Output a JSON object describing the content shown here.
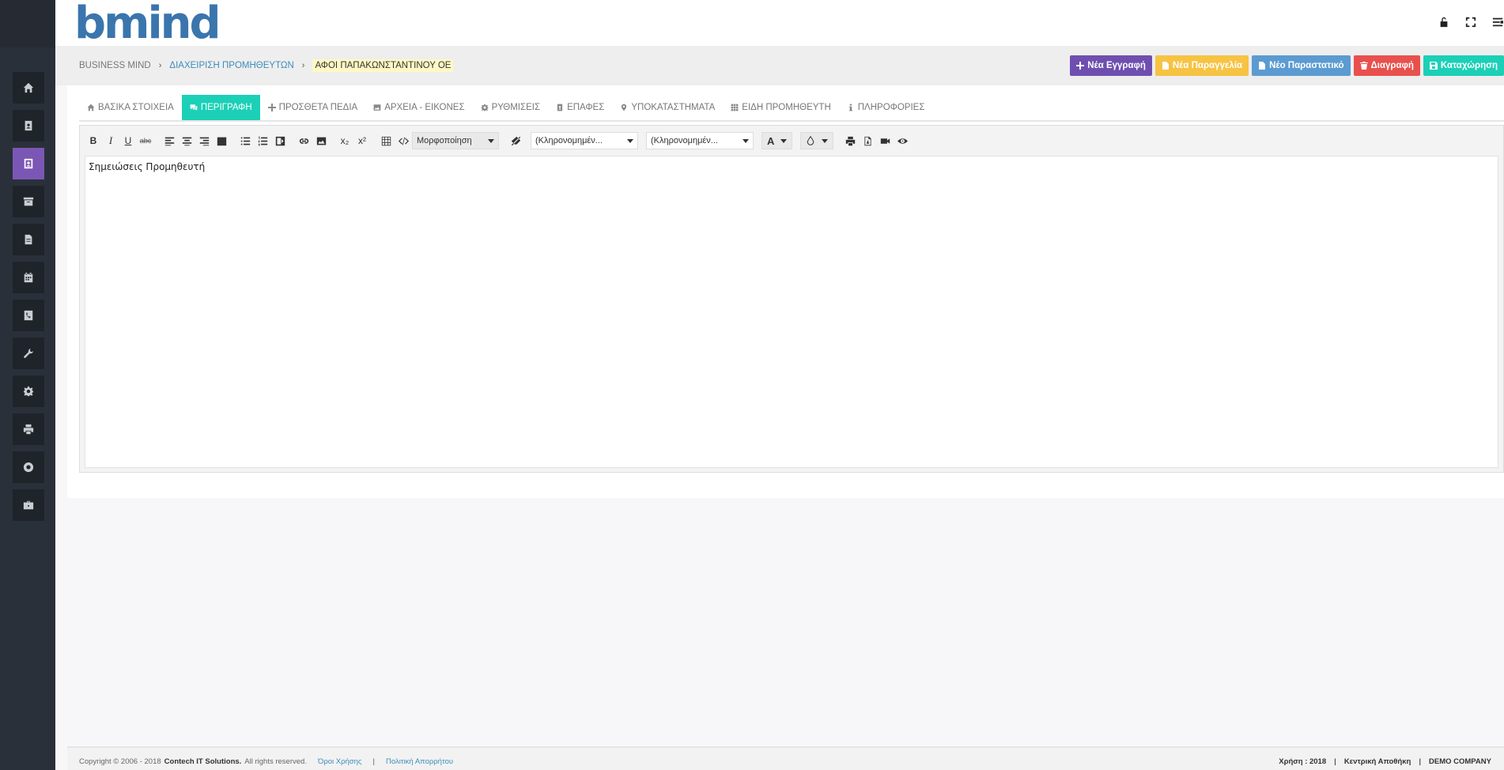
{
  "brand": {
    "logo_text": "bmind"
  },
  "sidebar": {
    "items": [
      {
        "icon": "home-icon"
      },
      {
        "icon": "contacts-book-icon"
      },
      {
        "icon": "supplier-card-icon",
        "active": true
      },
      {
        "icon": "archive-box-icon"
      },
      {
        "icon": "document-icon"
      },
      {
        "icon": "calendar-icon"
      },
      {
        "icon": "phone-icon"
      },
      {
        "icon": "wrench-icon"
      },
      {
        "icon": "gear-icon"
      },
      {
        "icon": "print-icon"
      },
      {
        "icon": "support-lifebuoy-icon"
      },
      {
        "icon": "briefcase-icon"
      }
    ]
  },
  "header": {
    "icons": [
      "unlock-icon",
      "fullscreen-icon",
      "menu-toggle-icon"
    ]
  },
  "breadcrumb": {
    "root": "BUSINESS MIND",
    "section": "ΔΙΑΧΕΙΡΙΣΗ ΠΡΟΜΗΘΕΥΤΩΝ",
    "current": "ΑΦΟΙ ΠΑΠΑΚΩΝΣΤΑΝΤΙΝΟΥ ΟΕ"
  },
  "actions": {
    "new_entry": "Νέα Εγγραφή",
    "new_order": "Νέα Παραγγελία",
    "new_document": "Νέο Παραστατικό",
    "delete": "Διαγραφή",
    "save": "Καταχώρηση"
  },
  "tabs": [
    {
      "label": "ΒΑΣΙΚΑ ΣΤΟΙΧΕΙΑ",
      "icon": "home-icon"
    },
    {
      "label": "ΠΕΡΙΓΡΑΦΗ",
      "icon": "comments-icon",
      "active": true
    },
    {
      "label": "ΠΡΟΣΘΕΤΑ ΠΕΔΙΑ",
      "icon": "plus-icon"
    },
    {
      "label": "ΑΡΧΕΙΑ - ΕΙΚΟΝΕΣ",
      "icon": "image-icon"
    },
    {
      "label": "ΡΥΘΜΙΣΕΙΣ",
      "icon": "gear-icon"
    },
    {
      "label": "ΕΠΑΦΕΣ",
      "icon": "contact-icon"
    },
    {
      "label": "ΥΠΟΚΑΤΑΣΤΗΜΑΤΑ",
      "icon": "map-marker-icon"
    },
    {
      "label": "ΕΙΔΗ ΠΡΟΜΗΘΕΥΤΗ",
      "icon": "grid-icon"
    },
    {
      "label": "ΠΛΗΡΟΦΟΡΙΕΣ",
      "icon": "info-icon"
    }
  ],
  "editor": {
    "format_select": "Μορφοποίηση",
    "font_select": "(Κληρονομημέν...",
    "size_select": "(Κληρονομημέν...",
    "font_color_label": "A",
    "content": "Σημειώσεις Προμηθευτή",
    "subscript_label": "x₂",
    "superscript_label": "x²",
    "strike_label": "abc"
  },
  "footer": {
    "copyright_prefix": "Copyright © 2006 - 2018",
    "company": "Contech IT Solutions.",
    "rights": "All rights reserved.",
    "terms": "Όροι Χρήσης",
    "privacy": "Πολιτική Απορρήτου",
    "fiscal_year": "Χρήση : 2018",
    "warehouse": "Κεντρική Αποθήκη",
    "company_name": "DEMO COMPANY"
  }
}
